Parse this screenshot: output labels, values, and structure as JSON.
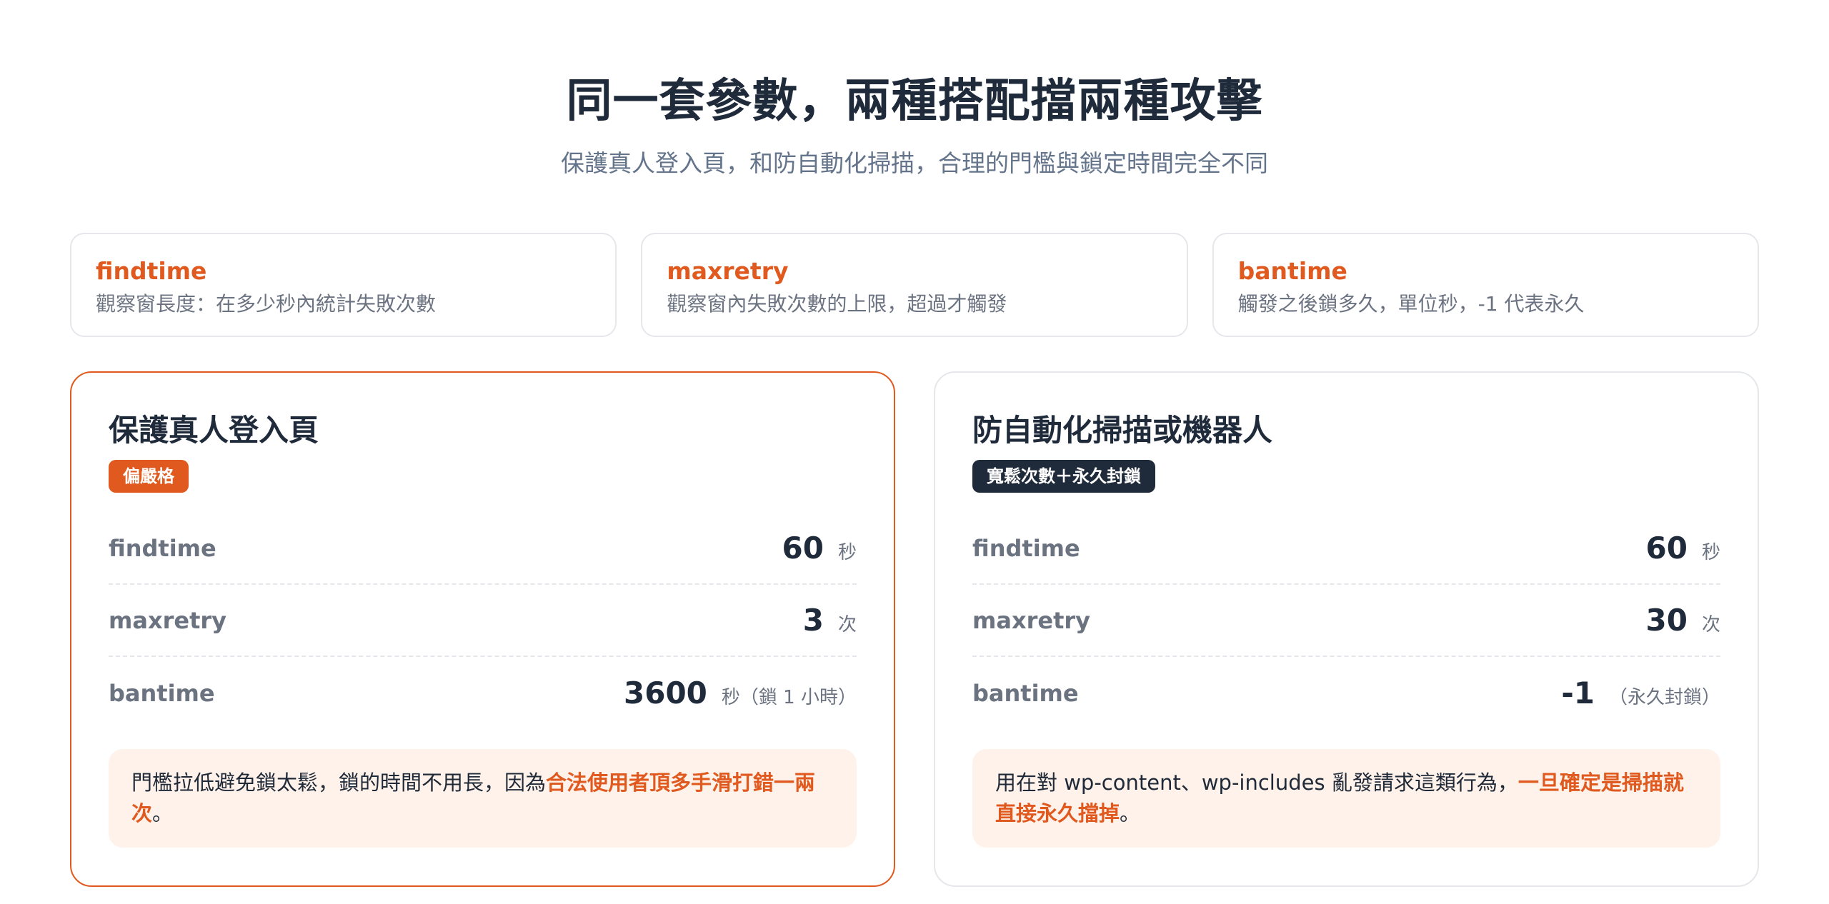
{
  "header": {
    "title": "同一套參數，兩種搭配擋兩種攻擊",
    "subtitle": "保護真人登入頁，和防自動化掃描，合理的門檻與鎖定時間完全不同"
  },
  "definitions": [
    {
      "term": "findtime",
      "desc": "觀察窗長度：在多少秒內統計失敗次數"
    },
    {
      "term": "maxretry",
      "desc": "觀察窗內失敗次數的上限，超過才觸發"
    },
    {
      "term": "bantime",
      "desc": "觸發之後鎖多久，單位秒，-1 代表永久"
    }
  ],
  "panels": [
    {
      "title": "保護真人登入頁",
      "badge": "偏嚴格",
      "params": [
        {
          "name": "findtime",
          "value": "60",
          "unit": "秒"
        },
        {
          "name": "maxretry",
          "value": "3",
          "unit": "次"
        },
        {
          "name": "bantime",
          "value": "3600",
          "unit": "秒（鎖 1 小時）"
        }
      ],
      "note": {
        "text": "門檻拉低避免鎖太鬆，鎖的時間不用長，因為",
        "highlight": "合法使用者頂多手滑打錯一兩次",
        "end": "。"
      }
    },
    {
      "title": "防自動化掃描或機器人",
      "badge": "寬鬆次數＋永久封鎖",
      "params": [
        {
          "name": "findtime",
          "value": "60",
          "unit": "秒"
        },
        {
          "name": "maxretry",
          "value": "30",
          "unit": "次"
        },
        {
          "name": "bantime",
          "value": "-1",
          "unit": "（永久封鎖）"
        }
      ],
      "note": {
        "text": "用在對 wp-content、wp-includes 亂發請求這類行為，",
        "highlight": "一旦確定是掃描就直接永久擋掉",
        "end": "。"
      }
    }
  ],
  "colors": {
    "accent": "#e05a1f",
    "dark": "#1f2a3a",
    "muted": "#6b7280",
    "note_bg": "#fff2ea"
  }
}
